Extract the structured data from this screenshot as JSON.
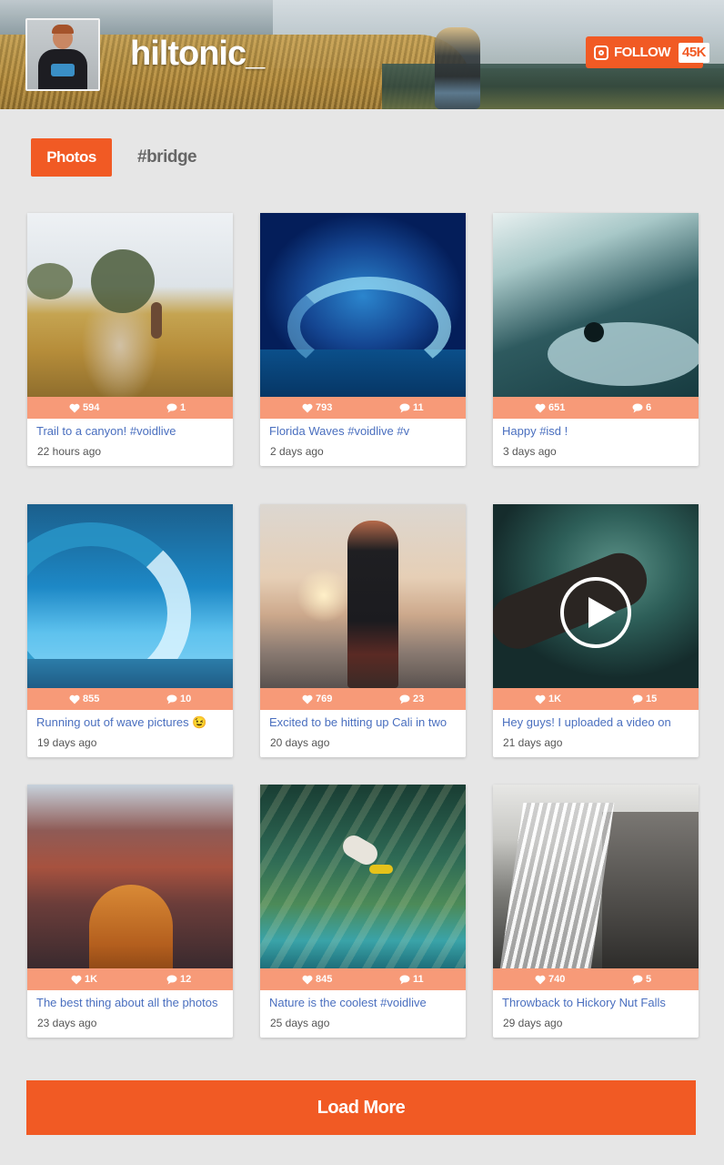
{
  "profile": {
    "username": "hiltonic_",
    "follow_label": "FOLLOW",
    "follower_count": "45K"
  },
  "tabs": [
    {
      "label": "Photos",
      "active": true
    },
    {
      "label": "#bridge",
      "active": false
    }
  ],
  "posts": [
    {
      "likes": "594",
      "comments": "1",
      "caption": "Trail to a canyon! #voidlive",
      "time": "22 hours ago",
      "photo": "trail",
      "video": false
    },
    {
      "likes": "793",
      "comments": "11",
      "caption": "Florida Waves #voidlive #v",
      "time": "2 days ago",
      "photo": "wave",
      "video": false
    },
    {
      "likes": "651",
      "comments": "6",
      "caption": "Happy #isd !",
      "time": "3 days ago",
      "photo": "surfer",
      "video": false
    },
    {
      "likes": "855",
      "comments": "10",
      "caption": "Running out of wave pictures 😉",
      "time": "19 days ago",
      "photo": "curl",
      "video": false
    },
    {
      "likes": "769",
      "comments": "23",
      "caption": "Excited to be hitting up Cali in two",
      "time": "20 days ago",
      "photo": "sunset",
      "video": false
    },
    {
      "likes": "1K",
      "comments": "15",
      "caption": "Hey guys! I uploaded a video on",
      "time": "21 days ago",
      "photo": "underwater",
      "video": true
    },
    {
      "likes": "1K",
      "comments": "12",
      "caption": "The best thing about all the photos",
      "time": "23 days ago",
      "photo": "canyon",
      "video": false
    },
    {
      "likes": "845",
      "comments": "11",
      "caption": "Nature is the coolest #voidlive",
      "time": "25 days ago",
      "photo": "diver",
      "video": false
    },
    {
      "likes": "740",
      "comments": "5",
      "caption": "Throwback to Hickory Nut Falls",
      "time": "29 days ago",
      "photo": "waterfall",
      "video": false
    }
  ],
  "load_more_label": "Load More",
  "colors": {
    "accent": "#f15a24",
    "stats_bar": "#f79a78",
    "caption_link": "#4a6fbf",
    "background": "#e6e6e6"
  },
  "icons": {
    "follow": "instagram-icon",
    "likes": "heart-icon",
    "comments": "comment-bubble-icon",
    "video": "play-icon"
  }
}
